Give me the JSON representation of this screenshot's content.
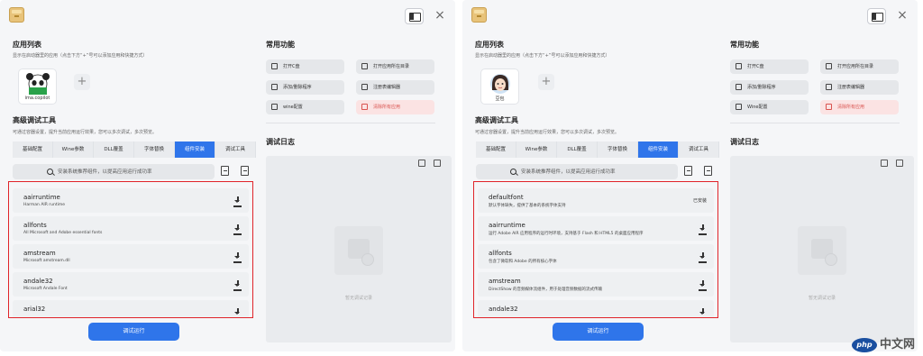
{
  "windows": [
    {
      "app_list": {
        "title": "应用列表",
        "desc": "显示在启动器里的应用（点击下方“+”号可以添加应用和快捷方式）",
        "app_name": "ima.copilot",
        "add_label": "+"
      },
      "advanced": {
        "title": "高级调试工具",
        "desc": "可通过容器设置，提升当前应用运行效果，您可以多次调试，多次预览。"
      },
      "tabs": [
        "基础配置",
        "Wine参数",
        "DLL覆盖",
        "字体替换",
        "组件安装",
        "调试工具"
      ],
      "search_placeholder": "安装系统推荐组件，以提高应用运行成功率",
      "packages": [
        {
          "name": "aairruntime",
          "desc": "Harman AIR runtime"
        },
        {
          "name": "allfonts",
          "desc": "All Microsoft and Adobe essential fonts"
        },
        {
          "name": "amstream",
          "desc": "Microsoft amstream.dll"
        },
        {
          "name": "andale32",
          "desc": "Microsoft Andale Font"
        },
        {
          "name": "arial32",
          "desc": ""
        }
      ],
      "run_label": "调试运行",
      "common": {
        "title": "常用功能",
        "buttons": [
          {
            "label": "打开C盘"
          },
          {
            "label": "打开应用所在目录"
          },
          {
            "label": "添加/删除程序"
          },
          {
            "label": "注册表编辑器"
          },
          {
            "label": "wine配置"
          },
          {
            "label": "清除所有应用"
          }
        ]
      },
      "log": {
        "title": "调试日志",
        "empty": "暂无调试记录"
      }
    },
    {
      "app_list": {
        "title": "应用列表",
        "desc": "显示在启动器里的应用（点击下方“+”号可以添加应用和快捷方式）",
        "app_name": "豆包",
        "add_label": "+"
      },
      "advanced": {
        "title": "高级调试工具",
        "desc": "可通过容器设置，提升当前应用运行效果，您可以多次调试，多次预览。"
      },
      "tabs": [
        "基础配置",
        "Wine参数",
        "DLL覆盖",
        "字体替换",
        "组件安装",
        "调试工具"
      ],
      "search_placeholder": "安装系统推荐组件，以提高应用运行成功率",
      "packages": [
        {
          "name": "defaultfont",
          "desc": "默认字体缺失，提供了基本的系统字体支持",
          "status": "已安装"
        },
        {
          "name": "aairruntime",
          "desc": "运行 Adobe AIR 应用程序的运行时环境，支持基于 Flash 和 HTML5 的桌面应用程序"
        },
        {
          "name": "allfonts",
          "desc": "包含了微软和 Adobe 的所有核心字体"
        },
        {
          "name": "amstream",
          "desc": "DirectShow 的音频媒体流组件，用于处理音频数据的流式传输"
        },
        {
          "name": "andale32",
          "desc": ""
        }
      ],
      "run_label": "调试运行",
      "common": {
        "title": "常用功能",
        "buttons": [
          {
            "label": "打开C盘"
          },
          {
            "label": "打开应用所在目录"
          },
          {
            "label": "添加/删除程序"
          },
          {
            "label": "注册表编辑器"
          },
          {
            "label": "Wine配置"
          },
          {
            "label": "清除所有应用"
          }
        ]
      },
      "log": {
        "title": "调试日志",
        "empty": "暂无调试记录"
      }
    }
  ],
  "close_symbol": "×",
  "watermark": {
    "logo": "php",
    "text": "中文网"
  },
  "colors": {
    "accent": "#2f75ea",
    "highlight_border": "#e0242a",
    "danger": "#d9534f"
  }
}
